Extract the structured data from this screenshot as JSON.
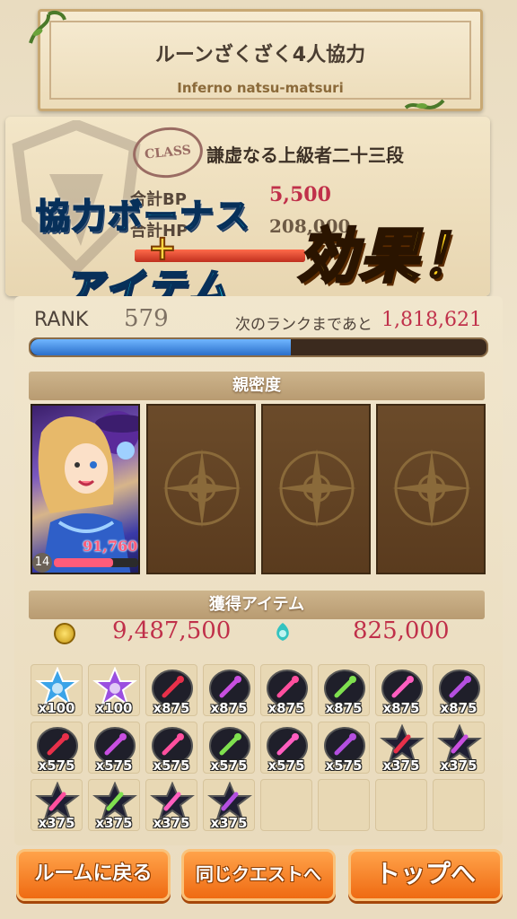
{
  "quest": {
    "name": "ルーンざくざく4人協力",
    "sub": "Inferno natsu-matsuri"
  },
  "class": {
    "stamp": "CLASS",
    "title": "謙虚なる上級者二十三段",
    "bp_label": "合計BP",
    "bp_value": "5,500",
    "hp_label": "合計HP",
    "hp_value": "208,000"
  },
  "banner": {
    "line1": "協力ボーナス",
    "plus": "+",
    "line2": "アイテム",
    "effect": "効果！"
  },
  "rank": {
    "label": "RANK",
    "value": "579",
    "next_label": "次のランクまであと",
    "next_value": "1,818,621",
    "progress": 0.57
  },
  "affinity": {
    "header": "親密度",
    "character_value": "91,760",
    "character_level": "14",
    "character_progress": 0.7
  },
  "items": {
    "header": "獲得アイテム",
    "coin_value": "9,487,500",
    "gem_value": "825,000",
    "list": [
      {
        "icon": "blue-star-icon",
        "qty": "x100",
        "color": "#3aa3e8"
      },
      {
        "icon": "purple-star-icon",
        "qty": "x100",
        "color": "#9b4fe0"
      },
      {
        "icon": "red-sword-rune-icon",
        "qty": "x875",
        "color": "#e8304a"
      },
      {
        "icon": "purple-staff-rune-icon",
        "qty": "x875",
        "color": "#c84fe0"
      },
      {
        "icon": "pink-sword-rune-icon",
        "qty": "x875",
        "color": "#ff4f9e"
      },
      {
        "icon": "green-hand-rune-icon",
        "qty": "x875",
        "color": "#7fe04f"
      },
      {
        "icon": "pink-armor-rune-icon",
        "qty": "x875",
        "color": "#ff5ec0"
      },
      {
        "icon": "purple-sword-rune-icon",
        "qty": "x875",
        "color": "#b44fe0"
      },
      {
        "icon": "red-sword-rune-icon",
        "qty": "x575",
        "color": "#e8304a"
      },
      {
        "icon": "purple-staff-rune-icon",
        "qty": "x575",
        "color": "#c84fe0"
      },
      {
        "icon": "pink-sword-rune-icon",
        "qty": "x575",
        "color": "#ff4f9e"
      },
      {
        "icon": "green-hand-rune-icon",
        "qty": "x575",
        "color": "#7fe04f"
      },
      {
        "icon": "pink-armor-rune-icon",
        "qty": "x575",
        "color": "#ff5ec0"
      },
      {
        "icon": "purple-sword-rune-icon",
        "qty": "x575",
        "color": "#b44fe0"
      },
      {
        "icon": "red-star-rune-icon",
        "qty": "x375",
        "color": "#e8304a"
      },
      {
        "icon": "purple-star-rune-icon",
        "qty": "x375",
        "color": "#c84fe0"
      },
      {
        "icon": "pink-star-rune-icon",
        "qty": "x375",
        "color": "#ff4f9e"
      },
      {
        "icon": "green-star-rune-icon",
        "qty": "x375",
        "color": "#7fe04f"
      },
      {
        "icon": "pink-star-rune-icon",
        "qty": "x375",
        "color": "#ff5ec0"
      },
      {
        "icon": "purple-star-rune-icon",
        "qty": "x375",
        "color": "#b44fe0"
      }
    ]
  },
  "buttons": {
    "back_room": "ルームに戻る",
    "same_quest": "同じクエストへ",
    "top": "トップへ"
  }
}
